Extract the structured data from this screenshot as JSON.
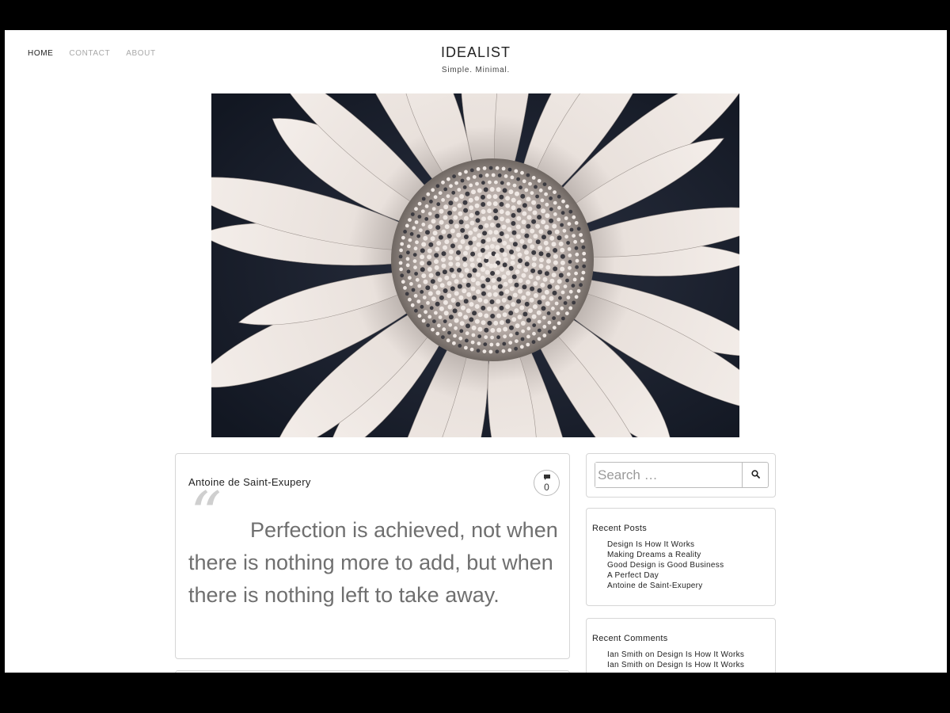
{
  "nav": {
    "items": [
      {
        "label": "HOME",
        "active": true
      },
      {
        "label": "CONTACT",
        "active": false
      },
      {
        "label": "ABOUT",
        "active": false
      }
    ]
  },
  "site": {
    "title": "IDEALIST",
    "tagline": "Simple. Minimal."
  },
  "hero": {
    "image": "daisy-flower-photo"
  },
  "post": {
    "title": "Antoine de Saint-Exupery",
    "comment_icon": "comment-bubble-icon",
    "comment_count": "0",
    "quote_mark": "“",
    "quote": "Perfection is achieved, not when there is nothing more to add, but when there is nothing left to take away."
  },
  "sidebar": {
    "search": {
      "placeholder": "Search …",
      "button_icon": "search-icon"
    },
    "recent_posts": {
      "title": "Recent Posts",
      "items": [
        "Design Is How It Works",
        "Making Dreams a Reality",
        "Good Design is Good Business",
        "A Perfect Day",
        "Antoine de Saint-Exupery"
      ]
    },
    "recent_comments": {
      "title": "Recent Comments",
      "items": [
        {
          "author": "Ian Smith",
          "on": "on",
          "post": "Design Is How It Works"
        },
        {
          "author": "Ian Smith",
          "on": "on",
          "post": "Design Is How It Works"
        }
      ]
    }
  },
  "colors": {
    "frame": "#000000",
    "page": "#ffffff",
    "nav_active": "#222222",
    "nav_inactive": "#a8a8a8",
    "quote_text": "#6f6f6f",
    "border": "#d6d6d6"
  }
}
